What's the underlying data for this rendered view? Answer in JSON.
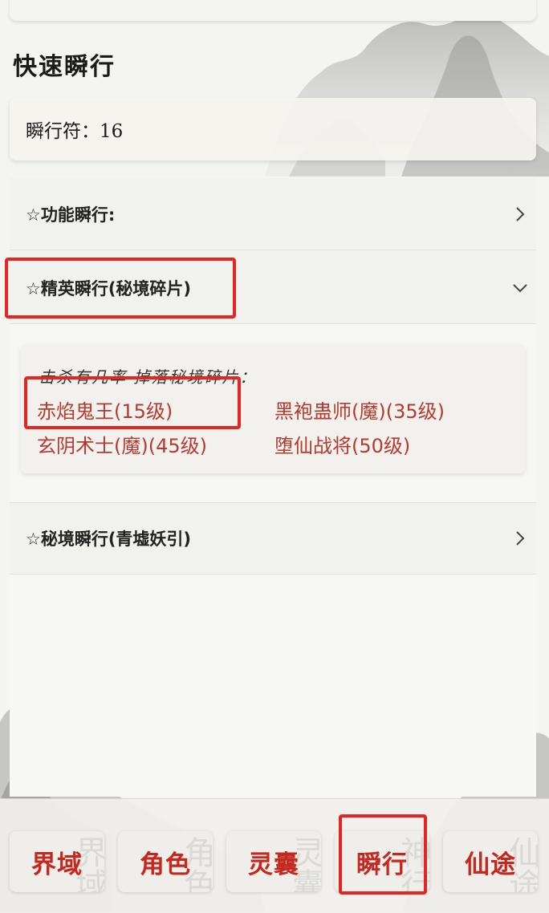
{
  "page": {
    "title": "快速瞬行"
  },
  "token": {
    "label": "瞬行符：16"
  },
  "sections": [
    {
      "title": "☆功能瞬行:",
      "expanded": false
    },
    {
      "title": "☆精英瞬行(秘境碎片)",
      "expanded": true
    },
    {
      "title": "☆秘境瞬行(青墟妖引)",
      "expanded": false
    }
  ],
  "drops": {
    "description": "击杀有几率 掉落秘境碎片：",
    "items": [
      "赤焰鬼王(15级)",
      "黑袍蛊师(魔)(35级)",
      "玄阴术士(魔)(45级)",
      "堕仙战将(50级)"
    ]
  },
  "nav": {
    "items": [
      {
        "label": "界域",
        "ghost": "界域"
      },
      {
        "label": "角色",
        "ghost": "角色"
      },
      {
        "label": "灵囊",
        "ghost": "灵囊"
      },
      {
        "label": "瞬行",
        "ghost": "神行"
      },
      {
        "label": "仙途",
        "ghost": "仙途"
      }
    ]
  },
  "colors": {
    "accent": "#c4281f",
    "link": "#b33a2e",
    "highlight": "#e52620"
  },
  "icons": {
    "collapsed": "chevron-right-icon",
    "expanded": "chevron-down-icon"
  }
}
